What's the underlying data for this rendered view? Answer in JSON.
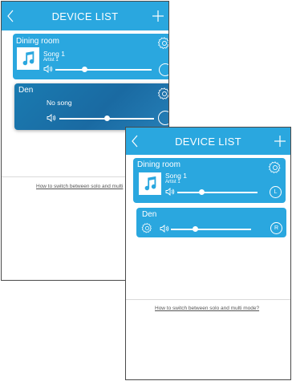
{
  "colors": {
    "accent": "#2aa7df",
    "selected_card": "#1a6aa2",
    "text_on_accent": "#ffffff",
    "link": "#555555"
  },
  "icons": [
    "chevron-left-icon",
    "plus-icon",
    "gear-icon",
    "music-note-icon",
    "speaker-volume-icon"
  ],
  "screen1": {
    "title": "DEVICE LIST",
    "devices": [
      {
        "room": "Dining room",
        "song": "Song 1",
        "artist": "Artist 1",
        "volume": 0.3
      },
      {
        "room": "Den",
        "song": "No song",
        "volume": 0.5
      }
    ],
    "help_link": "How to switch between solo and multi"
  },
  "screen2": {
    "title": "DEVICE LIST",
    "devices": [
      {
        "room": "Dining room",
        "song": "Song 1",
        "artist": "Artist 1",
        "volume": 0.3,
        "channel": "L"
      },
      {
        "room": "Den",
        "volume": 0.3,
        "channel": "R"
      }
    ],
    "help_link": "How to switch between solo and multi mode?"
  }
}
